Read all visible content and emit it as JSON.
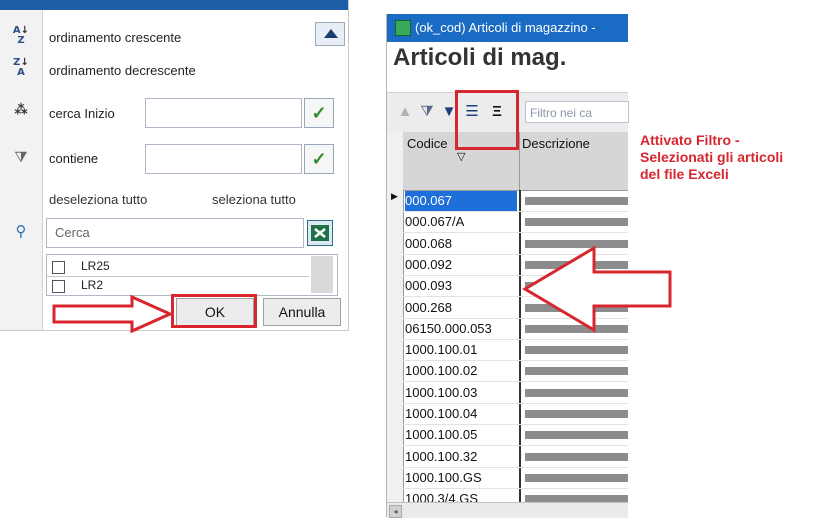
{
  "popup": {
    "sort_asc": "ordinamento crescente",
    "sort_desc": "ordinamento decrescente",
    "search_start_label": "cerca Inizio",
    "contains_label": "contiene",
    "deselect_all": "deseleziona tutto",
    "select_all": "seleziona tutto",
    "search_placeholder": "Cerca",
    "list_items": [
      "LR25",
      "LR2"
    ],
    "ok_label": "OK",
    "cancel_label": "Annulla",
    "icons": {
      "sort_asc": "sort-az-icon",
      "sort_desc": "sort-za-icon",
      "search_start": "binoculars-icon",
      "contains": "filter-icon",
      "search": "search-icon",
      "excel": "excel-icon",
      "check": "check-icon",
      "up": "arrow-up-icon"
    }
  },
  "window": {
    "title": "(ok_cod) Articoli di magazzino -",
    "heading": "Articoli di mag.",
    "filter_placeholder": "Filtro nei ca",
    "columns": [
      "Codice",
      "Descrizione"
    ],
    "rows": [
      "000.067",
      "000.067/A",
      "000.068",
      "000.092",
      "000.093",
      "000.268",
      "06150.000.053",
      "1000.100.01",
      "1000.100.02",
      "1000.100.03",
      "1000.100.04",
      "1000.100.05",
      "1000.100.32",
      "1000.100.GS",
      "1000.3/4.GS"
    ],
    "selected_row": "000.067"
  },
  "annotation": {
    "lines": [
      "Attivato Filtro -",
      "Selezionati gli articoli",
      "del file Exceli"
    ]
  },
  "colors": {
    "accent_blue": "#1a6bc3",
    "highlight_red": "#d7262e",
    "selection_blue": "#1e6fd9",
    "check_green": "#2e8b2e"
  }
}
